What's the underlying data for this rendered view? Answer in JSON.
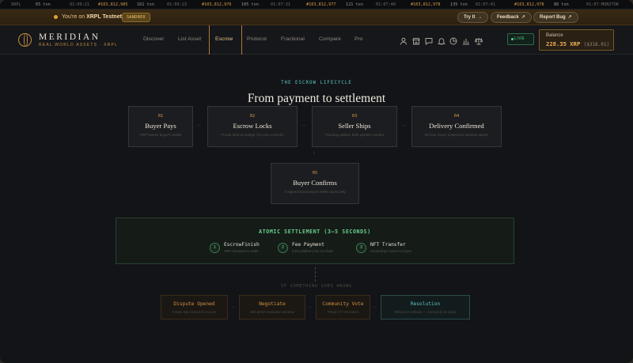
{
  "ticker": [
    {
      "text": "XRPL",
      "kind": "label"
    },
    {
      "text": "65 txn",
      "kind": "txn"
    },
    {
      "text": "01:09:21",
      "kind": "time"
    },
    {
      "text": "#103,812,985",
      "kind": "num"
    },
    {
      "text": "161 txn",
      "kind": "txn"
    },
    {
      "text": "01:09:23",
      "kind": "time"
    },
    {
      "text": "#103,812,976",
      "kind": "num"
    },
    {
      "text": "105 txn",
      "kind": "txn"
    },
    {
      "text": "01:07:31",
      "kind": "time"
    },
    {
      "text": "#103,812,977",
      "kind": "num"
    },
    {
      "text": "121 txn",
      "kind": "txn"
    },
    {
      "text": "01:07:40",
      "kind": "time"
    },
    {
      "text": "#103,812,978",
      "kind": "num"
    },
    {
      "text": "135 txn",
      "kind": "txn"
    },
    {
      "text": "01:07:41",
      "kind": "time"
    },
    {
      "text": "#103,812,978",
      "kind": "num"
    },
    {
      "text": "86 txn",
      "kind": "txn"
    },
    {
      "text": "01:07:",
      "kind": "time"
    },
    {
      "text": "MONITOR",
      "kind": "label"
    }
  ],
  "notice": {
    "prefix": "You're on ",
    "network": "XRPL Testnet",
    "badge": "SANDBOX",
    "try_label": "Try It",
    "feedback_label": "Feedback",
    "report_label": "Report Bug"
  },
  "nav": {
    "brand": "MERIDIAN",
    "brand_sub": "REAL WORLD ASSETS · XRPL",
    "items": [
      "Discover",
      "List Asset",
      "Escrow",
      "Protocol",
      "Fractional",
      "Compare",
      "Pro"
    ],
    "active": "Escrow",
    "live_label": "LIVE",
    "balance_label": "Balance",
    "balance_value": "228.35 XRP",
    "balance_usd": "($318.01)",
    "icons": [
      "user-icon",
      "store-icon",
      "chat-icon",
      "bell-icon",
      "pie-chart-icon",
      "bar-chart-icon",
      "scale-icon"
    ]
  },
  "lifecycle": {
    "eyebrow": "THE ESCROW LIFECYCLE",
    "title": "From payment to settlement",
    "steps": [
      {
        "num": "01",
        "title": "Buyer Pays",
        "desc": "XRP leaves buyer's wallet"
      },
      {
        "num": "02",
        "title": "Escrow Locks",
        "desc": "Funds held on-ledger (no one controls)"
      },
      {
        "num": "03",
        "title": "Seller Ships",
        "desc": "Tracking added, both parties monitor"
      },
      {
        "num": "04",
        "title": "Delivery Confirmed",
        "desc": "(8-hour buyer inspection window starts)"
      },
      {
        "num": "05",
        "title": "Buyer Confirms",
        "desc": "3 signed transactions settle atomically"
      }
    ]
  },
  "settlement": {
    "heading": "ATOMIC SETTLEMENT (3–5 SECONDS)",
    "items": [
      {
        "num": "1",
        "title": "EscrowFinish",
        "desc": "XRP released to seller"
      },
      {
        "num": "2",
        "title": "Fee Payment",
        "desc": "0.5% platform fee on-chain"
      },
      {
        "num": "3",
        "title": "NFT Transfer",
        "desc": "Ownership moves to buyer"
      }
    ]
  },
  "dispute": {
    "heading": "IF SOMETHING GOES WRONG",
    "steps": [
      {
        "title": "Dispute Opened",
        "desc": "Funds stay locked in escrow"
      },
      {
        "title": "Negotiate",
        "desc": "48h direct resolution window"
      },
      {
        "title": "Community Vote",
        "desc": "Panel of 7-25 voters"
      },
      {
        "title": "Resolution",
        "desc": "Refund or release — executed on-chain"
      }
    ]
  },
  "colors": {
    "accent": "#c98e3e",
    "settle_green": "#6ad08e",
    "resolution_teal": "#5fbfc0",
    "live_green": "#5ccf8d"
  }
}
